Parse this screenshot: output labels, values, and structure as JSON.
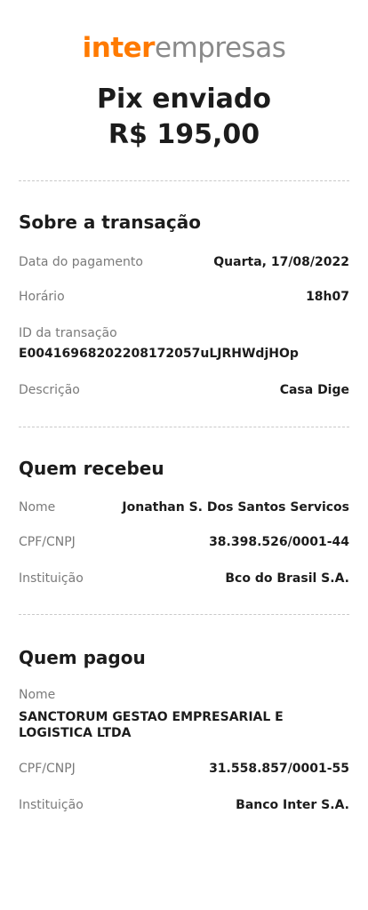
{
  "brand": {
    "name_primary": "inter",
    "name_secondary": "empresas",
    "primary_color": "#ff7a00",
    "secondary_color": "#8a8a8a"
  },
  "receipt": {
    "title": "Pix enviado",
    "amount": "R$ 195,00"
  },
  "transaction": {
    "section_title": "Sobre a transação",
    "payment_date_label": "Data do pagamento",
    "payment_date_value": "Quarta, 17/08/2022",
    "time_label": "Horário",
    "time_value": "18h07",
    "id_label": "ID da transação",
    "id_value": "E00416968202208172057uLJRHWdjHOp",
    "description_label": "Descrição",
    "description_value": "Casa Dige"
  },
  "recipient": {
    "section_title": "Quem recebeu",
    "name_label": "Nome",
    "name_value": "Jonathan S. Dos Santos Servicos",
    "doc_label": "CPF/CNPJ",
    "doc_value": "38.398.526/0001-44",
    "institution_label": "Instituição",
    "institution_value": "Bco do Brasil S.A."
  },
  "payer": {
    "section_title": "Quem pagou",
    "name_label": "Nome",
    "name_value": "SANCTORUM GESTAO EMPRESARIAL E LOGISTICA LTDA",
    "doc_label": "CPF/CNPJ",
    "doc_value": "31.558.857/0001-55",
    "institution_label": "Instituição",
    "institution_value": "Banco Inter S.A."
  }
}
